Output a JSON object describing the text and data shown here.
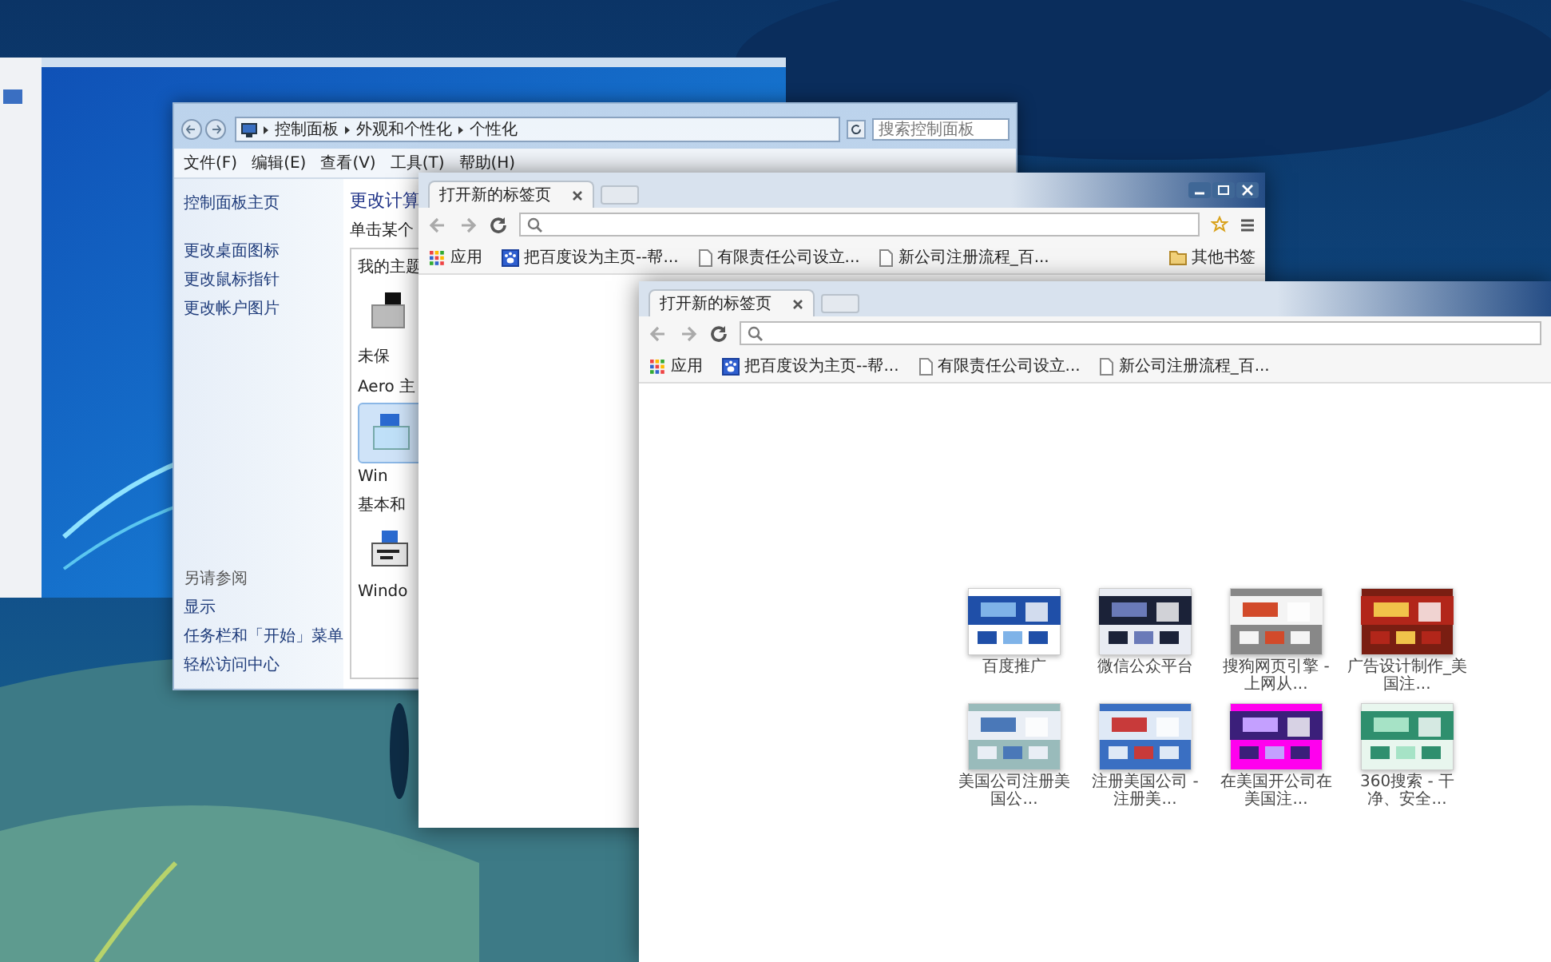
{
  "windows": [
    {
      "kind": "wallpaper"
    },
    {
      "kind": "control_panel",
      "breadcrumb": [
        "控制面板",
        "外观和个性化",
        "个性化"
      ],
      "search": {
        "placeholder": "搜索控制面板"
      },
      "menu": [
        "文件(F)",
        "编辑(E)",
        "查看(V)",
        "工具(T)",
        "帮助(H)"
      ],
      "sidebar": {
        "title": "控制面板主页",
        "links": [
          "更改桌面图标",
          "更改鼠标指针",
          "更改帐户图片"
        ]
      },
      "heading": "更改计算",
      "subheading": "单击某个",
      "groups": [
        {
          "title": "我的主题",
          "item": "未保",
          "selected": false
        },
        {
          "title": "Aero 主",
          "item": "Win",
          "selected": true
        },
        {
          "title": "基本和",
          "item": "Windo",
          "selected": false
        }
      ],
      "see_also": {
        "title": "另请参阅",
        "links": [
          "显示",
          "任务栏和「开始」菜单",
          "轻松访问中心"
        ]
      }
    },
    {
      "kind": "browser",
      "tab": "打开新的标签页",
      "controls": true,
      "apps": "应用",
      "bookmarks": [
        "把百度设为主页--帮...",
        "有限责任公司设立...",
        "新公司注册流程_百..."
      ],
      "other_bookmarks": "其他书签"
    },
    {
      "kind": "browser",
      "tab": "打开新的标签页",
      "controls": false,
      "apps": "应用",
      "bookmarks": [
        "把百度设为主页--帮...",
        "有限责任公司设立...",
        "新公司注册流程_百..."
      ],
      "tiles": [
        {
          "label": "百度推广"
        },
        {
          "label": "微信公众平台"
        },
        {
          "label": "搜狗网页引擎 - 上网从..."
        },
        {
          "label": "广告设计制作_美国注..."
        },
        {
          "label": "美国公司注册美国公..."
        },
        {
          "label": "注册美国公司 - 注册美..."
        },
        {
          "label": "在美国开公司在美国注..."
        },
        {
          "label": "360搜索 - 干净、安全..."
        }
      ]
    }
  ]
}
